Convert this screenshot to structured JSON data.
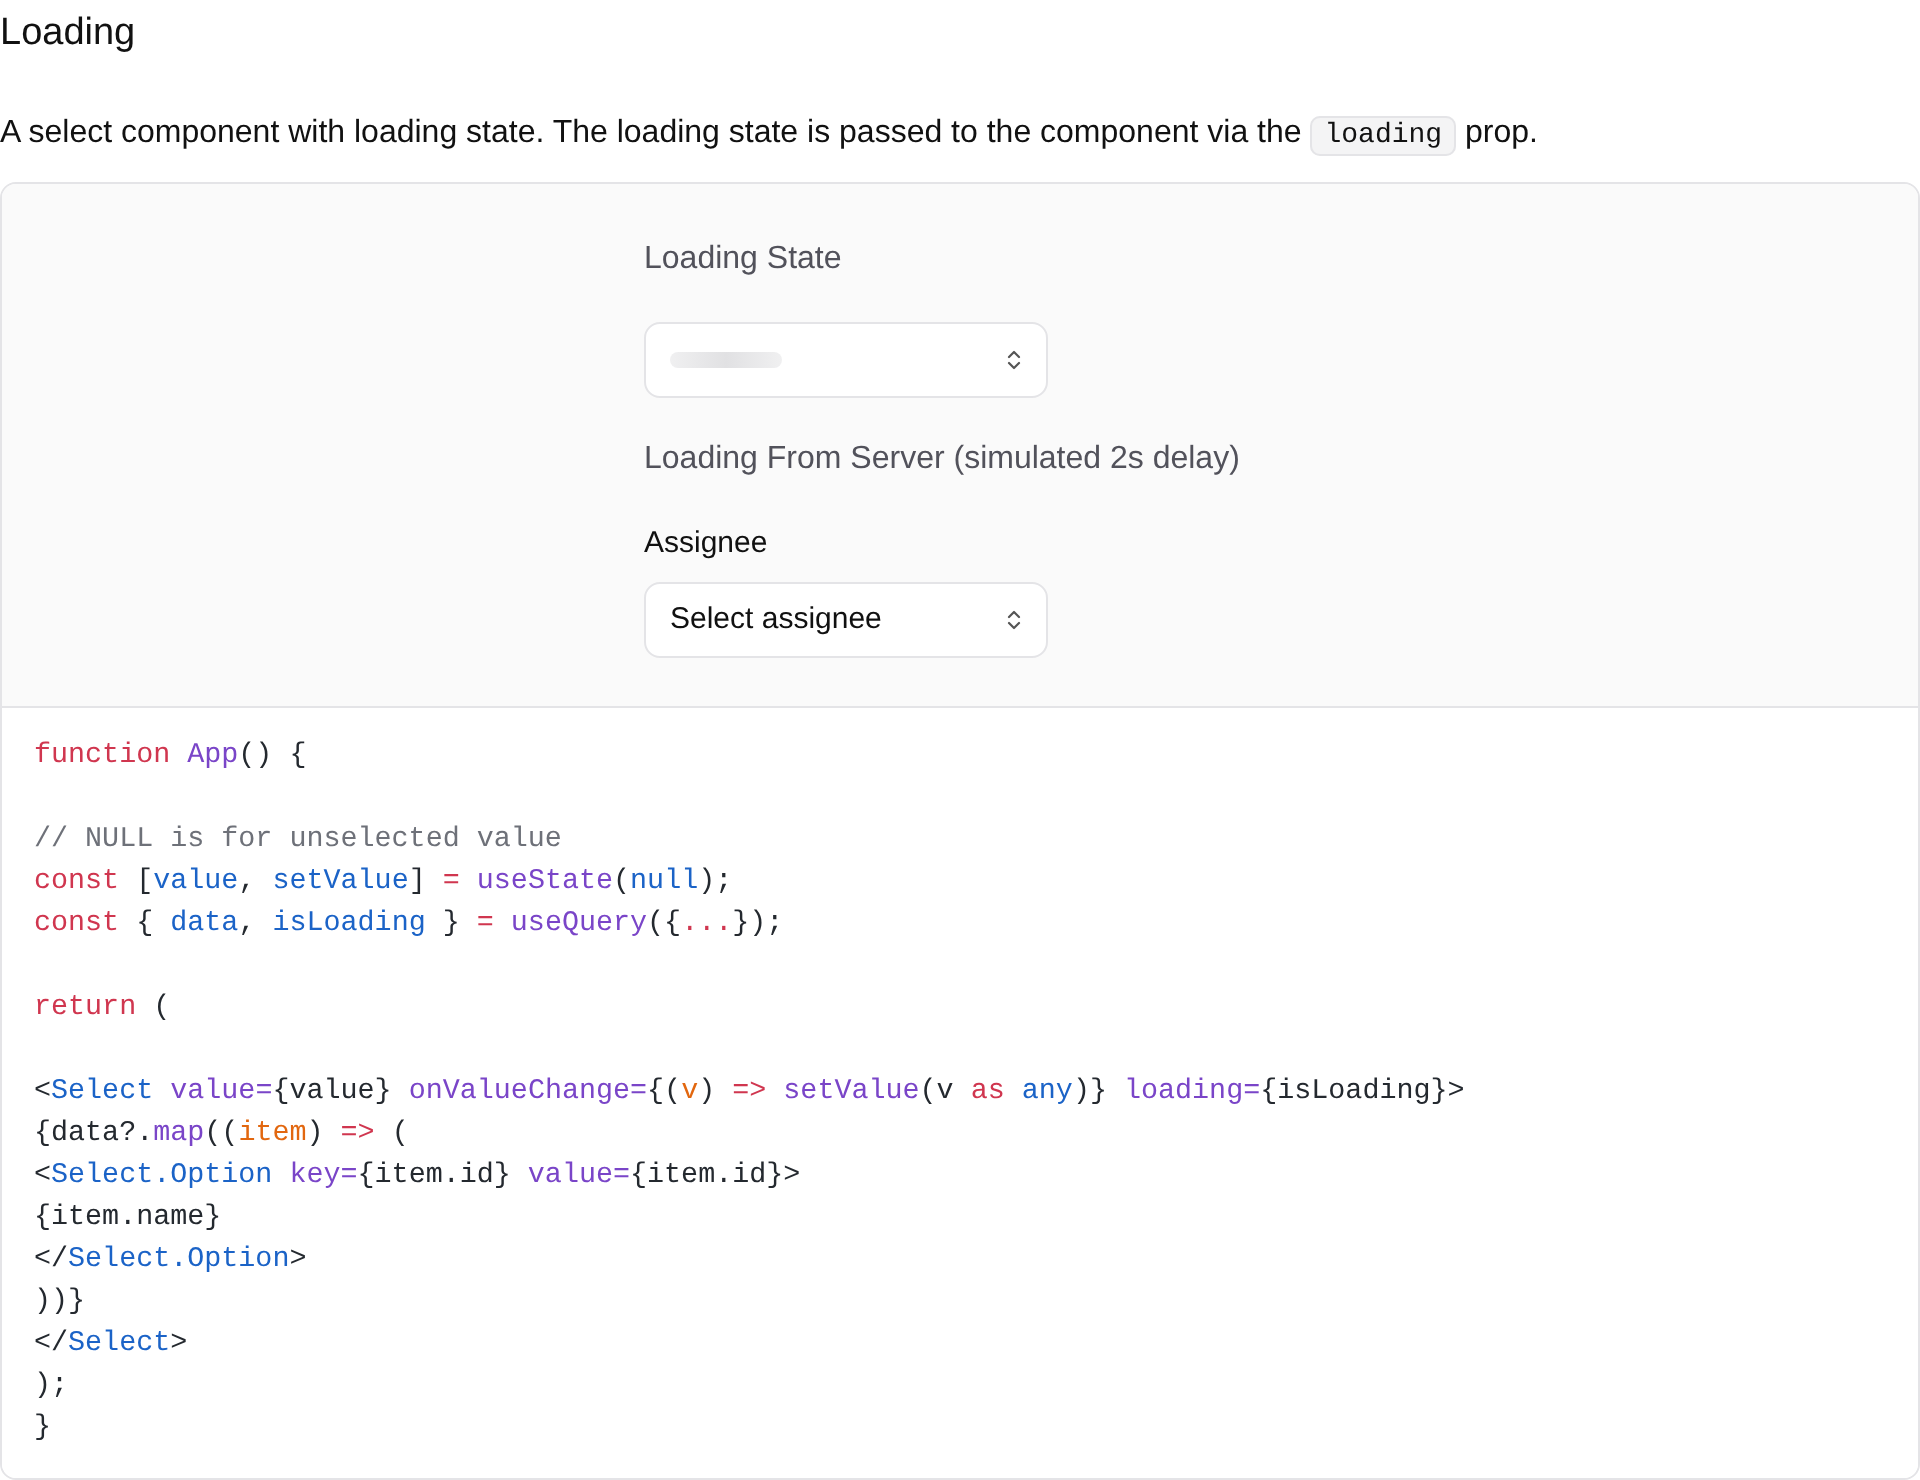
{
  "heading": "Loading",
  "description": [
    {
      "kind": "text",
      "text": "A select component with loading state. The loading state is passed to the component via the "
    },
    {
      "kind": "code",
      "text": "loading"
    },
    {
      "kind": "text",
      "text": " prop."
    }
  ],
  "demo": [
    {
      "title": "Loading State",
      "select": {
        "loading": true
      }
    },
    {
      "title": "Loading From Server (simulated 2s delay)",
      "select": {
        "label": "Assignee",
        "placeholder": "Select assignee",
        "loading": false
      }
    }
  ],
  "code": [
    {
      "kind": "code",
      "tokens": [
        {
          "kind": "keyword",
          "text": "function "
        },
        {
          "kind": "function",
          "text": "App"
        },
        {
          "kind": "plain",
          "text": "() {"
        }
      ]
    },
    {
      "kind": "blank"
    },
    {
      "kind": "code",
      "tokens": [
        {
          "kind": "comment",
          "text": "// NULL is for unselected value"
        }
      ]
    },
    {
      "kind": "code",
      "tokens": [
        {
          "kind": "keyword",
          "text": "const"
        },
        {
          "kind": "plain",
          "text": " ["
        },
        {
          "kind": "identifier",
          "text": "value"
        },
        {
          "kind": "plain",
          "text": ", "
        },
        {
          "kind": "identifier",
          "text": "setValue"
        },
        {
          "kind": "plain",
          "text": "] "
        },
        {
          "kind": "keyword",
          "text": "= "
        },
        {
          "kind": "function",
          "text": "useState"
        },
        {
          "kind": "plain",
          "text": "("
        },
        {
          "kind": "identifier",
          "text": "null"
        },
        {
          "kind": "plain",
          "text": ");"
        }
      ]
    },
    {
      "kind": "code",
      "tokens": [
        {
          "kind": "keyword",
          "text": "const"
        },
        {
          "kind": "plain",
          "text": " { "
        },
        {
          "kind": "identifier",
          "text": "data"
        },
        {
          "kind": "plain",
          "text": ", "
        },
        {
          "kind": "identifier",
          "text": "isLoading"
        },
        {
          "kind": "plain",
          "text": " } "
        },
        {
          "kind": "keyword",
          "text": "= "
        },
        {
          "kind": "function",
          "text": "useQuery"
        },
        {
          "kind": "plain",
          "text": "({"
        },
        {
          "kind": "keyword",
          "text": "..."
        },
        {
          "kind": "plain",
          "text": "});"
        }
      ]
    },
    {
      "kind": "blank"
    },
    {
      "kind": "code",
      "tokens": [
        {
          "kind": "keyword",
          "text": "return"
        },
        {
          "kind": "plain",
          "text": " ("
        }
      ]
    },
    {
      "kind": "blank"
    },
    {
      "kind": "code",
      "tokens": [
        {
          "kind": "plain",
          "text": "<"
        },
        {
          "kind": "identifier",
          "text": "Select "
        },
        {
          "kind": "function",
          "text": "value="
        },
        {
          "kind": "plain",
          "text": "{value} "
        },
        {
          "kind": "function",
          "text": "onValueChange="
        },
        {
          "kind": "plain",
          "text": "{("
        },
        {
          "kind": "param",
          "text": "v"
        },
        {
          "kind": "plain",
          "text": ") "
        },
        {
          "kind": "keyword",
          "text": "=> "
        },
        {
          "kind": "function",
          "text": "setValue"
        },
        {
          "kind": "plain",
          "text": "(v "
        },
        {
          "kind": "keyword",
          "text": "as "
        },
        {
          "kind": "identifier",
          "text": "any"
        },
        {
          "kind": "plain",
          "text": ")} "
        },
        {
          "kind": "function",
          "text": "loading="
        },
        {
          "kind": "plain",
          "text": "{isLoading}>"
        }
      ]
    },
    {
      "kind": "code",
      "tokens": [
        {
          "kind": "plain",
          "text": "{data?."
        },
        {
          "kind": "function",
          "text": "map"
        },
        {
          "kind": "plain",
          "text": "(("
        },
        {
          "kind": "param",
          "text": "item"
        },
        {
          "kind": "plain",
          "text": ") "
        },
        {
          "kind": "keyword",
          "text": "=>"
        },
        {
          "kind": "plain",
          "text": " ("
        }
      ]
    },
    {
      "kind": "code",
      "tokens": [
        {
          "kind": "plain",
          "text": "<"
        },
        {
          "kind": "identifier",
          "text": "Select.Option "
        },
        {
          "kind": "function",
          "text": "key="
        },
        {
          "kind": "plain",
          "text": "{item.id} "
        },
        {
          "kind": "function",
          "text": "value="
        },
        {
          "kind": "plain",
          "text": "{item.id}>"
        }
      ]
    },
    {
      "kind": "code",
      "tokens": [
        {
          "kind": "plain",
          "text": "{item.name}"
        }
      ]
    },
    {
      "kind": "code",
      "tokens": [
        {
          "kind": "plain",
          "text": "</"
        },
        {
          "kind": "identifier",
          "text": "Select.Option"
        },
        {
          "kind": "plain",
          "text": ">"
        }
      ]
    },
    {
      "kind": "code",
      "tokens": [
        {
          "kind": "plain",
          "text": "))}"
        }
      ]
    },
    {
      "kind": "code",
      "tokens": [
        {
          "kind": "plain",
          "text": "</"
        },
        {
          "kind": "identifier",
          "text": "Select"
        },
        {
          "kind": "plain",
          "text": ">"
        }
      ]
    },
    {
      "kind": "code",
      "tokens": [
        {
          "kind": "plain",
          "text": ");"
        }
      ]
    },
    {
      "kind": "code",
      "tokens": [
        {
          "kind": "plain",
          "text": "}"
        }
      ]
    }
  ]
}
